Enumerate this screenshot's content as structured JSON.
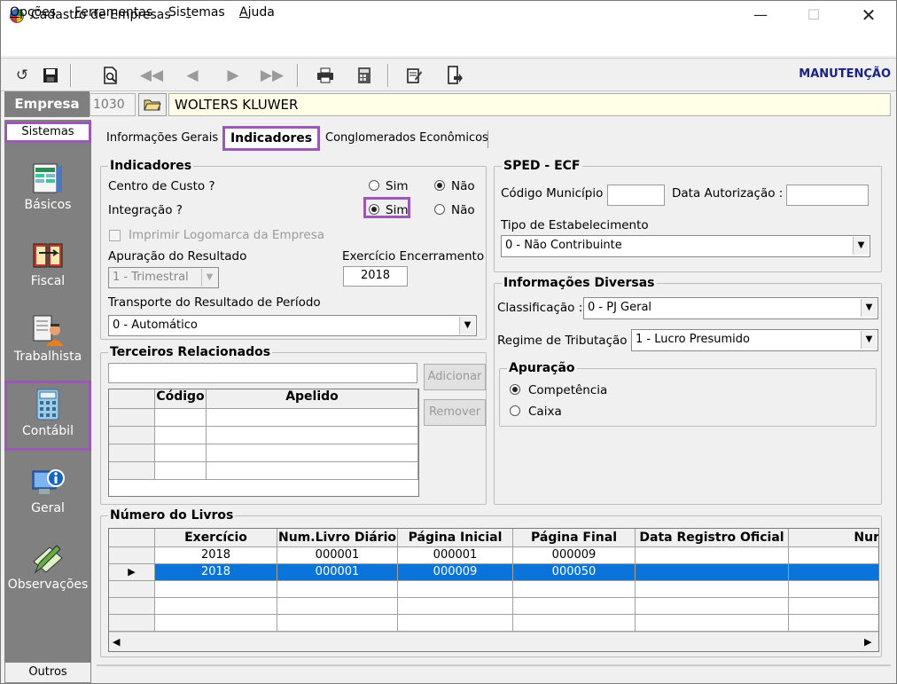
{
  "window": {
    "title": "Cadastro de Empresas"
  },
  "menu": [
    "Opções",
    "Ferramentas",
    "Sistemas",
    "Ajuda"
  ],
  "menu_underline": [
    "O",
    "F",
    "t",
    "A"
  ],
  "toolbar": {
    "mode_label": "MANUTENÇÃO"
  },
  "empresa": {
    "label": "Empresa",
    "code": "1030",
    "name": "WOLTERS KLUWER"
  },
  "sidebar": {
    "header": "Sistemas",
    "items": [
      {
        "label": "Básicos",
        "icon": "spreadsheet-icon"
      },
      {
        "label": "Fiscal",
        "icon": "book-icon"
      },
      {
        "label": "Trabalhista",
        "icon": "worker-icon"
      },
      {
        "label": "Contábil",
        "icon": "calculator-icon"
      },
      {
        "label": "Geral",
        "icon": "info-computer-icon"
      },
      {
        "label": "Observações",
        "icon": "notes-pen-icon"
      }
    ],
    "selected": "Contábil",
    "footer": "Outros"
  },
  "tabs": [
    "Informações Gerais",
    "Indicadores",
    "Conglomerados Econômicos"
  ],
  "active_tab": "Indicadores",
  "indicadores": {
    "legend": "Indicadores",
    "centro_custo_label": "Centro de Custo ?",
    "centro_custo_value": "Não",
    "integracao_label": "Integração ?",
    "integracao_value": "Sim",
    "sim": "Sim",
    "nao": "Não",
    "imprimir_logo_label": "Imprimir Logomarca da Empresa",
    "apuracao_label": "Apuração do Resultado",
    "apuracao_value": "1 - Trimestral",
    "exercicio_label": "Exercício Encerramento",
    "exercicio_value": "2018",
    "transporte_label": "Transporte do Resultado de Período",
    "transporte_value": "0 - Automático"
  },
  "terceiros": {
    "legend": "Terceiros Relacionados",
    "add_label": "Adicionar",
    "remove_label": "Remover",
    "columns": [
      "Código",
      "Apelido"
    ]
  },
  "sped": {
    "legend": "SPED - ECF",
    "municipio_label": "Código Município :",
    "autorizacao_label": "Data Autorização :",
    "tipo_label": "Tipo de Estabelecimento",
    "tipo_value": "0 - Não Contribuinte"
  },
  "diversas": {
    "legend": "Informações Diversas",
    "classificacao_label": "Classificação :",
    "classificacao_value": "0 - PJ Geral",
    "regime_label": "Regime de Tributação :",
    "regime_value": "1 - Lucro Presumido",
    "apuracao_legend": "Apuração",
    "competencia": "Competência",
    "caixa": "Caixa",
    "apuracao_value": "Competência"
  },
  "livros": {
    "legend": "Número do Livros",
    "columns": [
      "Exercício",
      "Num.Livro Diário",
      "Página Inicial",
      "Página Final",
      "Data Registro Oficial",
      "Nur"
    ],
    "rows": [
      {
        "exercicio": "2018",
        "livro": "000001",
        "inicial": "000001",
        "final": "000009",
        "data": ""
      },
      {
        "exercicio": "2018",
        "livro": "000001",
        "inicial": "000009",
        "final": "000050",
        "data": ""
      }
    ],
    "selected_row": 1
  },
  "colors": {
    "highlight": "#9b59b6",
    "selection": "#0a74da",
    "sidebar": "#808080",
    "name_field": "#ffffe8"
  }
}
